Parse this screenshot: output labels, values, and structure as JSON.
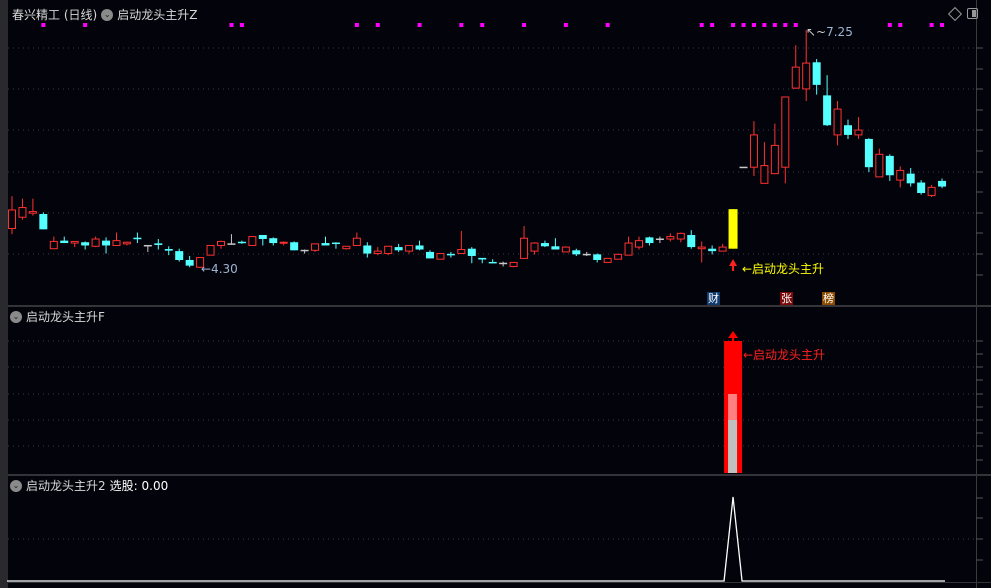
{
  "header": {
    "stock_title": "春兴精工 (日线)",
    "indicator_main": "启动龙头主升Z"
  },
  "panel2": {
    "title": "启动龙头主升F",
    "signal_label": "←启动龙头主升"
  },
  "panel3": {
    "title": "启动龙头主升2",
    "value_label": "选股: 0.00"
  },
  "main_chart": {
    "max_label": "7.25",
    "min_label": "←4.30",
    "signal_label": "←启动龙头主升",
    "signal_index": 69,
    "badges": [
      {
        "text": "财",
        "color": "#0e3a6e",
        "index": 66
      },
      {
        "text": "张",
        "color": "#7a0a0a",
        "index": 73
      },
      {
        "text": "榜",
        "color": "#8a4a00",
        "index": 77
      }
    ],
    "dot_indices": [
      3,
      7,
      21,
      22,
      33,
      35,
      39,
      43,
      45,
      49,
      53,
      57,
      66,
      67,
      69,
      70,
      71,
      72,
      73,
      74,
      75,
      84,
      85,
      88,
      89
    ],
    "colors": {
      "up": "#ff3030",
      "down": "#54ffff",
      "flat": "#c8c8c8",
      "signal": "#ffff00",
      "dot": "#ff00ff"
    }
  },
  "chart_data": {
    "type": "candlestick",
    "price_range": [
      4.3,
      7.25
    ],
    "ohlc": [
      [
        4.79,
        5.19,
        4.72,
        5.02
      ],
      [
        4.93,
        5.16,
        4.9,
        5.05
      ],
      [
        4.98,
        5.16,
        4.95,
        5.0
      ],
      [
        4.97,
        4.99,
        4.78,
        4.78
      ],
      [
        4.54,
        4.69,
        4.54,
        4.63
      ],
      [
        4.64,
        4.69,
        4.61,
        4.61
      ],
      [
        4.61,
        4.63,
        4.56,
        4.63
      ],
      [
        4.62,
        4.63,
        4.53,
        4.58
      ],
      [
        4.57,
        4.69,
        4.56,
        4.66
      ],
      [
        4.64,
        4.68,
        4.48,
        4.58
      ],
      [
        4.58,
        4.74,
        4.58,
        4.64
      ],
      [
        4.6,
        4.63,
        4.58,
        4.62
      ],
      [
        4.67,
        4.74,
        4.61,
        4.66
      ],
      [
        4.58,
        4.58,
        4.5,
        4.58
      ],
      [
        4.6,
        4.66,
        4.53,
        4.58
      ],
      [
        4.53,
        4.57,
        4.46,
        4.51
      ],
      [
        4.51,
        4.54,
        4.38,
        4.4
      ],
      [
        4.4,
        4.45,
        4.31,
        4.33
      ],
      [
        4.31,
        4.43,
        4.3,
        4.43
      ],
      [
        4.46,
        4.58,
        4.46,
        4.58
      ],
      [
        4.58,
        4.64,
        4.54,
        4.63
      ],
      [
        4.6,
        4.72,
        4.6,
        4.6
      ],
      [
        4.62,
        4.64,
        4.6,
        4.61
      ],
      [
        4.58,
        4.69,
        4.58,
        4.69
      ],
      [
        4.71,
        4.71,
        4.58,
        4.66
      ],
      [
        4.67,
        4.68,
        4.58,
        4.61
      ],
      [
        4.61,
        4.63,
        4.58,
        4.62
      ],
      [
        4.62,
        4.63,
        4.52,
        4.52
      ],
      [
        4.52,
        4.53,
        4.48,
        4.52
      ],
      [
        4.52,
        4.6,
        4.5,
        4.6
      ],
      [
        4.61,
        4.69,
        4.58,
        4.58
      ],
      [
        4.61,
        4.62,
        4.54,
        4.6
      ],
      [
        4.54,
        4.57,
        4.53,
        4.57
      ],
      [
        4.58,
        4.74,
        4.58,
        4.67
      ],
      [
        4.58,
        4.62,
        4.43,
        4.48
      ],
      [
        4.48,
        4.56,
        4.46,
        4.51
      ],
      [
        4.48,
        4.57,
        4.46,
        4.57
      ],
      [
        4.56,
        4.6,
        4.5,
        4.52
      ],
      [
        4.51,
        4.58,
        4.48,
        4.58
      ],
      [
        4.58,
        4.64,
        4.52,
        4.53
      ],
      [
        4.5,
        4.52,
        4.42,
        4.42
      ],
      [
        4.41,
        4.48,
        4.41,
        4.48
      ],
      [
        4.47,
        4.5,
        4.43,
        4.46
      ],
      [
        4.48,
        4.76,
        4.48,
        4.53
      ],
      [
        4.54,
        4.56,
        4.36,
        4.45
      ],
      [
        4.42,
        4.42,
        4.36,
        4.4
      ],
      [
        4.37,
        4.41,
        4.36,
        4.36
      ],
      [
        4.36,
        4.38,
        4.32,
        4.36
      ],
      [
        4.32,
        4.37,
        4.31,
        4.37
      ],
      [
        4.42,
        4.82,
        4.42,
        4.67
      ],
      [
        4.51,
        4.62,
        4.47,
        4.61
      ],
      [
        4.61,
        4.64,
        4.56,
        4.57
      ],
      [
        4.57,
        4.67,
        4.53,
        4.53
      ],
      [
        4.5,
        4.57,
        4.5,
        4.56
      ],
      [
        4.52,
        4.54,
        4.45,
        4.47
      ],
      [
        4.47,
        4.5,
        4.45,
        4.47
      ],
      [
        4.47,
        4.48,
        4.37,
        4.4
      ],
      [
        4.37,
        4.42,
        4.37,
        4.42
      ],
      [
        4.41,
        4.48,
        4.41,
        4.47
      ],
      [
        4.46,
        4.69,
        4.46,
        4.61
      ],
      [
        4.56,
        4.69,
        4.53,
        4.64
      ],
      [
        4.68,
        4.69,
        4.58,
        4.61
      ],
      [
        4.66,
        4.69,
        4.61,
        4.66
      ],
      [
        4.66,
        4.73,
        4.63,
        4.69
      ],
      [
        4.66,
        4.74,
        4.62,
        4.73
      ],
      [
        4.71,
        4.77,
        4.54,
        4.56
      ],
      [
        4.54,
        4.63,
        4.37,
        4.56
      ],
      [
        4.54,
        4.58,
        4.47,
        4.51
      ],
      [
        4.51,
        4.6,
        4.51,
        4.56
      ],
      [
        4.54,
        5.03,
        4.54,
        5.03
      ],
      [
        5.55,
        5.55,
        5.55,
        5.55
      ],
      [
        5.55,
        6.12,
        5.44,
        5.95
      ],
      [
        5.35,
        5.86,
        5.35,
        5.57
      ],
      [
        5.47,
        6.09,
        5.47,
        5.82
      ],
      [
        5.55,
        6.42,
        5.35,
        6.42
      ],
      [
        6.53,
        7.06,
        6.52,
        6.79
      ],
      [
        6.52,
        7.25,
        6.37,
        6.84
      ],
      [
        6.85,
        6.89,
        6.45,
        6.57
      ],
      [
        6.44,
        6.69,
        6.06,
        6.07
      ],
      [
        5.95,
        6.37,
        5.82,
        6.27
      ],
      [
        6.07,
        6.14,
        5.9,
        5.95
      ],
      [
        5.95,
        6.17,
        5.9,
        6.01
      ],
      [
        5.9,
        5.91,
        5.49,
        5.55
      ],
      [
        5.43,
        5.78,
        5.43,
        5.71
      ],
      [
        5.69,
        5.71,
        5.38,
        5.45
      ],
      [
        5.39,
        5.56,
        5.3,
        5.51
      ],
      [
        5.47,
        5.54,
        5.31,
        5.35
      ],
      [
        5.36,
        5.39,
        5.21,
        5.23
      ],
      [
        5.2,
        5.33,
        5.18,
        5.3
      ],
      [
        5.38,
        5.41,
        5.29,
        5.31
      ]
    ],
    "indicator_F": {
      "signal_index": 69,
      "value": 1,
      "inner_levels": [
        0.6,
        0.4
      ]
    },
    "indicator_2": {
      "signal_index": 69,
      "values_nonzero_at": 69,
      "peak": 1
    }
  }
}
